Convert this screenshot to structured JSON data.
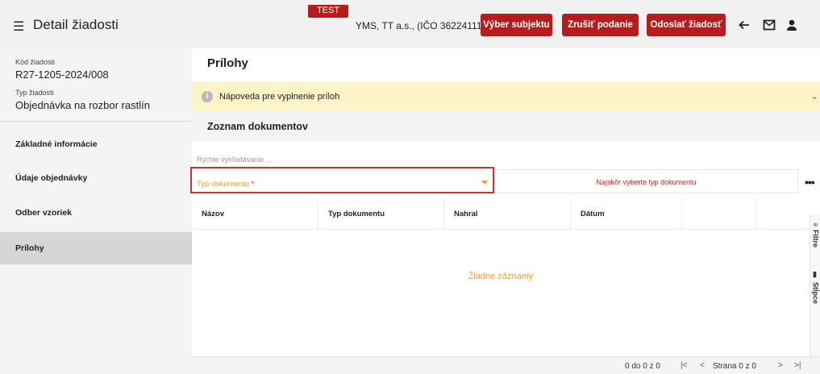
{
  "header": {
    "title": "Detail žiadosti",
    "test_badge": "TEST",
    "subject": "YMS, TT a.s., (IČO 36224111)",
    "buttons": {
      "select_subject": "Výber subjektu",
      "cancel_submission": "Zrušiť podanie",
      "send_request": "Odoslať žiadosť"
    },
    "icons": [
      "menu-icon",
      "arrow-back-icon",
      "mail-icon",
      "user-icon"
    ]
  },
  "sidebar": {
    "code_label": "Kód žiadosti",
    "code_value": "R27-1205-2024/008",
    "type_label": "Typ žiadosti",
    "type_value": "Objednávka na rozbor rastlín",
    "items": [
      {
        "label": "Základné informácie"
      },
      {
        "label": "Údaje objednávky"
      },
      {
        "label": "Odber vzoriek"
      },
      {
        "label": "Prílohy"
      }
    ],
    "active_index": 3
  },
  "main": {
    "section_title": "Prílohy",
    "help_label": "Nápoveda pre vyplnenie príloh",
    "list_title": "Zoznam dokumentov",
    "search_placeholder": "Rýchle vyhľadávanie ...",
    "doc_type_label": "Typ dokumentu",
    "doc_type_required": "*",
    "doc_hint": "Najskôr vyberte typ dokumentu",
    "more": "•••",
    "columns": [
      "Názov",
      "Typ dokumentu",
      "Nahral",
      "Dátum"
    ],
    "empty_text": "Žiadne záznamy",
    "side_tools": {
      "filters": "Filtre",
      "columns": "Stĺpce"
    },
    "pager": {
      "range": "0 do 0 z 0",
      "page": "Strana 0 z 0",
      "first": "|<",
      "prev": "<",
      "next": ">",
      "last": ">|"
    }
  },
  "colors": {
    "accent": "#b71c1c",
    "highlight_border": "#d32f2f",
    "warning_bg": "#fdf3c9",
    "orange_text": "#f0a030"
  }
}
